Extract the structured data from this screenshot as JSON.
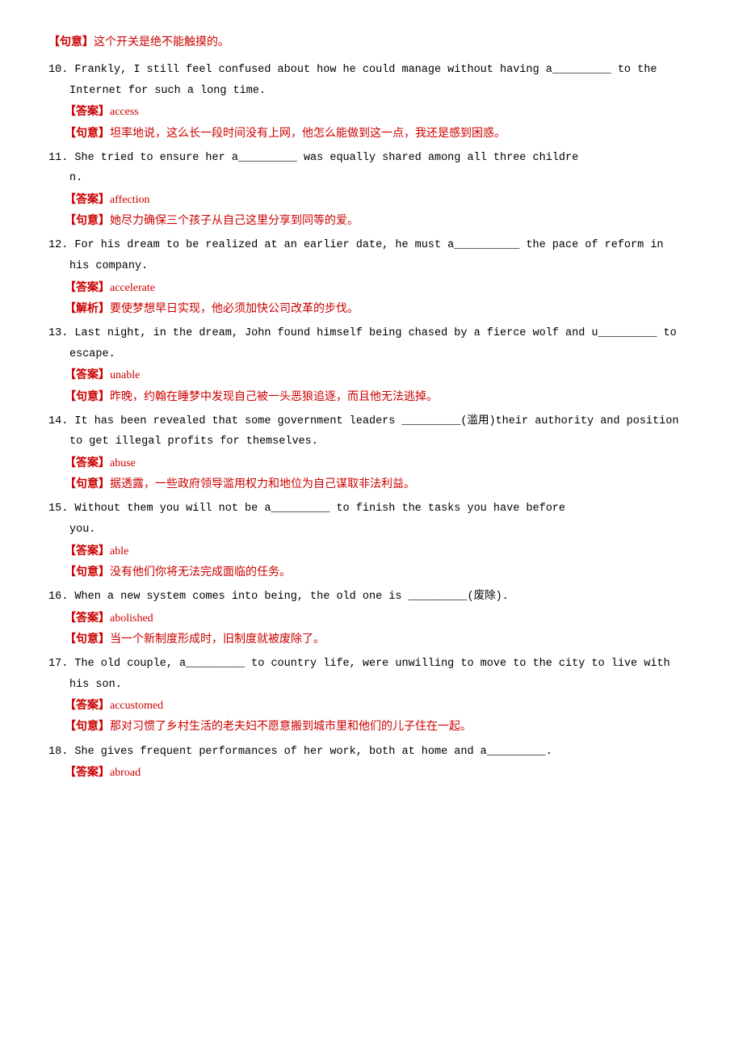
{
  "top_note": {
    "bracket": "【句意】",
    "text": "这个开关是绝不能触摸的。"
  },
  "questions": [
    {
      "num": "10.",
      "line1": "Frankly, I still feel confused about how he could manage without having a_________ to  the",
      "line2": "Internet for such a long time.",
      "answer_bracket": "【答案】",
      "answer": "access",
      "sentence_bracket": "【句意】",
      "sentence": "坦率地说，这么长一段时间没有上网，他怎么能做到这一点，我还是感到困惑。"
    },
    {
      "num": "11.",
      "line1": "She  tried  to  ensure  her  a_________  was  equally  shared  among  all  three  childre",
      "line2": "n.",
      "answer_bracket": "【答案】",
      "answer": "affection",
      "sentence_bracket": "【句意】",
      "sentence": "她尽力确保三个孩子从自己这里分享到同等的爱。"
    },
    {
      "num": "12.",
      "line1": "For his dream to be realized at an earlier date, he must a__________ the pace of reform in",
      "line2": "his company.",
      "answer_bracket": "【答案】",
      "answer": "accelerate",
      "extra_bracket": "【解析】",
      "extra_text": "要使梦想早日实现，他必须加快公司改革的步伐。"
    },
    {
      "num": "13.",
      "line1": "Last night, in the dream, John found himself being chased by a fierce wolf and u_________ to",
      "line2": "escape.",
      "answer_bracket": "【答案】",
      "answer": "unable",
      "sentence_bracket": "【句意】",
      "sentence": "昨晚，约翰在睡梦中发现自己被一头恶狼追逐，而且他无法逃掉。"
    },
    {
      "num": "14.",
      "line1": "It has been revealed that some government leaders _________(滥用)their authority and position",
      "line2": "to get illegal profits for themselves.",
      "answer_bracket": "【答案】",
      "answer": "abuse",
      "sentence_bracket": "【句意】",
      "sentence": "据透露，一些政府领导滥用权力和地位为自己谋取非法利益。"
    },
    {
      "num": "15.",
      "line1": "Without  them  you  will  not  be  a_________  to  finish  the  tasks  you  have  before",
      "line2": "   you.",
      "answer_bracket": "【答案】",
      "answer": "able",
      "sentence_bracket": "【句意】",
      "sentence": "没有他们你将无法完成面临的任务。"
    },
    {
      "num": "16.",
      "line1": "When a new system comes into being, the old one is _________(废除).",
      "line2": null,
      "answer_bracket": "【答案】",
      "answer": "abolished",
      "sentence_bracket": "【句意】",
      "sentence": "当一个新制度形成时，旧制度就被废除了。"
    },
    {
      "num": "17.",
      "line1": "The old couple, a_________  to  country life, were unwilling to move to the city to live with",
      "line2": "his son.",
      "answer_bracket": "【答案】",
      "answer": "accustomed",
      "sentence_bracket": "【句意】",
      "sentence": "那对习惯了乡村生活的老夫妇不愿意搬到城市里和他们的儿子住在一起。"
    },
    {
      "num": "18.",
      "line1": "She  gives  frequent  performances  of  her  work,  both at  home  and a_________.",
      "line2": null,
      "answer_bracket": "【答案】",
      "answer": "abroad",
      "sentence_bracket": null,
      "sentence": null
    }
  ]
}
